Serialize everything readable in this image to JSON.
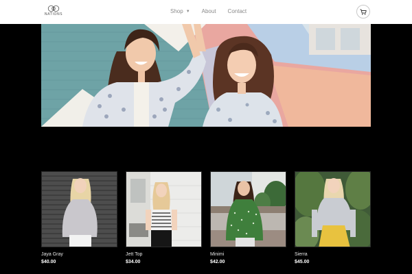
{
  "header": {
    "logo_text": "NATIONS",
    "nav": [
      {
        "label": "Shop",
        "has_dropdown": true
      },
      {
        "label": "About",
        "has_dropdown": false
      },
      {
        "label": "Contact",
        "has_dropdown": false
      }
    ],
    "cart_icon": "shopping-cart-icon"
  },
  "products": [
    {
      "name": "Jaya Gray",
      "price": "$40.00"
    },
    {
      "name": "Jett Top",
      "price": "$34.00"
    },
    {
      "name": "Minimi",
      "price": "$42.00"
    },
    {
      "name": "Sierra",
      "price": "$45.00"
    }
  ],
  "colors": {
    "page_background": "#000000",
    "header_background": "#ffffff",
    "nav_text": "#8a8a8a"
  }
}
